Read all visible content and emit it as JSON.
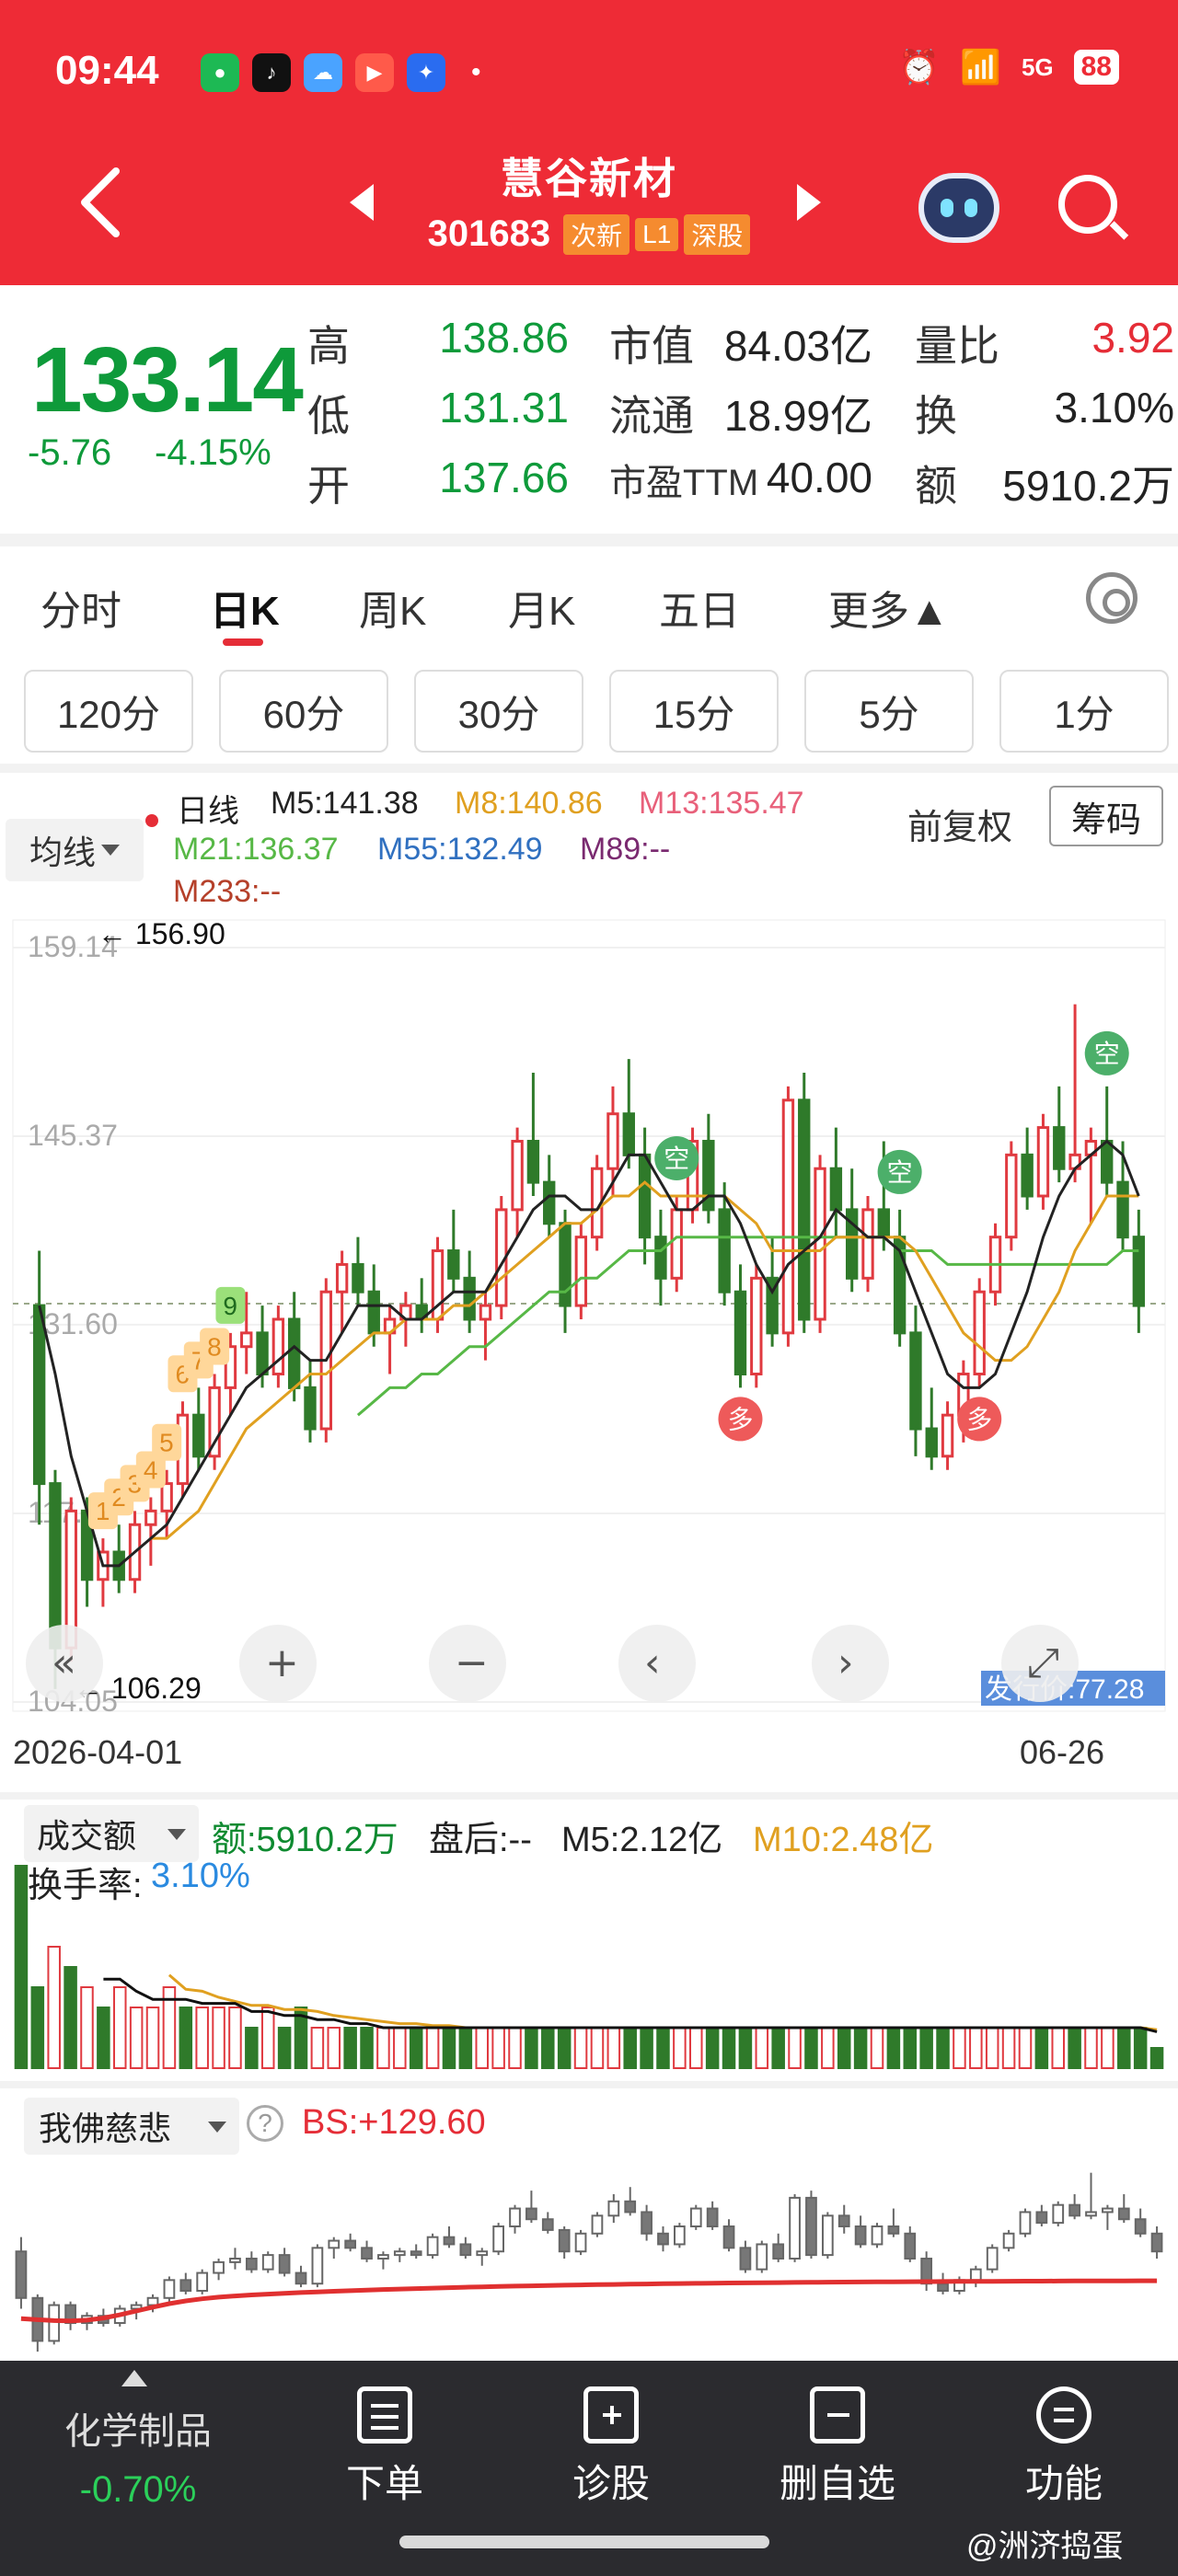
{
  "status_bar": {
    "time": "09:44",
    "battery": "88",
    "signal": "5G"
  },
  "header": {
    "stock_name": "慧谷新材",
    "code": "301683",
    "tags": [
      "次新",
      "L1",
      "深股"
    ]
  },
  "quote": {
    "price": "133.14",
    "change": "-5.76",
    "change_pct": "-4.15%",
    "rows": [
      {
        "l1": "高",
        "v1": "138.86",
        "l2": "市值",
        "v2": "84.03亿",
        "l3": "量比",
        "v3": "3.92"
      },
      {
        "l1": "低",
        "v1": "131.31",
        "l2": "流通",
        "v2": "18.99亿",
        "l3": "换",
        "v3": "3.10%"
      },
      {
        "l1": "开",
        "v1": "137.66",
        "l2": "市盈TTM",
        "v2": "40.00",
        "l3": "额",
        "v3": "5910.2万"
      }
    ]
  },
  "tabs": [
    "分时",
    "日K",
    "周K",
    "月K",
    "五日",
    "更多▲"
  ],
  "active_tab": "日K",
  "periods": [
    "120分",
    "60分",
    "30分",
    "15分",
    "5分",
    "1分"
  ],
  "ma_bar": {
    "selector": "均线",
    "title": "日线",
    "items": [
      {
        "label": "M5:141.38",
        "color": "#222222"
      },
      {
        "label": "M8:140.86",
        "color": "#e0a020"
      },
      {
        "label": "M13:135.47",
        "color": "#e8607a"
      },
      {
        "label": "M21:136.37",
        "color": "#57b846"
      },
      {
        "label": "M55:132.49",
        "color": "#3070c0"
      },
      {
        "label": "M89:--",
        "color": "#7a2a70"
      },
      {
        "label": "M233:--",
        "color": "#b5402a"
      }
    ],
    "adjust": "前复权",
    "chip_button": "筹码"
  },
  "chart_data": {
    "type": "candlestick",
    "y_ticks": [
      "159.14",
      "145.37",
      "131.60",
      "117.82",
      "104.05"
    ],
    "ylim": [
      104.05,
      159.14
    ],
    "annotations": {
      "high": "156.90",
      "low": "106.29",
      "issue_price": "发行价:77.28",
      "signals_kong": [
        "空",
        "空",
        "空"
      ],
      "signals_duo": [
        "多",
        "多"
      ],
      "counters": [
        "1",
        "2",
        "3",
        "4",
        "5",
        "6",
        "7",
        "8",
        "9"
      ]
    },
    "dates": [
      "2026-04-01",
      "06-26"
    ],
    "candles": [
      [
        133,
        137,
        117,
        120
      ],
      [
        120,
        121,
        105,
        108
      ],
      [
        108,
        119,
        107,
        118
      ],
      [
        118,
        119,
        111,
        113
      ],
      [
        113,
        116,
        111,
        115
      ],
      [
        115,
        117,
        112,
        113
      ],
      [
        113,
        118,
        112,
        117
      ],
      [
        117,
        119,
        114,
        118
      ],
      [
        118,
        121,
        116,
        120
      ],
      [
        120,
        126,
        119,
        125
      ],
      [
        125,
        127,
        121,
        122
      ],
      [
        122,
        128,
        121,
        127
      ],
      [
        127,
        131,
        125,
        130
      ],
      [
        130,
        134,
        128,
        131
      ],
      [
        131,
        133,
        127,
        128
      ],
      [
        128,
        133,
        127,
        132
      ],
      [
        132,
        134,
        126,
        127
      ],
      [
        127,
        129,
        123,
        124
      ],
      [
        124,
        135,
        123,
        134
      ],
      [
        134,
        137,
        131,
        136
      ],
      [
        136,
        138,
        133,
        134
      ],
      [
        134,
        136,
        130,
        131
      ],
      [
        131,
        133,
        128,
        132
      ],
      [
        132,
        134,
        130,
        133
      ],
      [
        133,
        135,
        131,
        132
      ],
      [
        132,
        138,
        131,
        137
      ],
      [
        137,
        140,
        134,
        135
      ],
      [
        135,
        137,
        131,
        132
      ],
      [
        132,
        134,
        129,
        133
      ],
      [
        133,
        141,
        132,
        140
      ],
      [
        140,
        146,
        138,
        145
      ],
      [
        145,
        150,
        141,
        142
      ],
      [
        142,
        144,
        138,
        139
      ],
      [
        139,
        140,
        131,
        133
      ],
      [
        133,
        139,
        132,
        138
      ],
      [
        138,
        144,
        137,
        143
      ],
      [
        143,
        149,
        141,
        147
      ],
      [
        147,
        151,
        143,
        144
      ],
      [
        144,
        146,
        136,
        138
      ],
      [
        138,
        140,
        133,
        135
      ],
      [
        135,
        141,
        134,
        140
      ],
      [
        140,
        146,
        139,
        145
      ],
      [
        145,
        147,
        139,
        140
      ],
      [
        140,
        142,
        133,
        134
      ],
      [
        134,
        136,
        127,
        128
      ],
      [
        128,
        136,
        127,
        135
      ],
      [
        135,
        138,
        130,
        131
      ],
      [
        131,
        149,
        130,
        148
      ],
      [
        148,
        150,
        131,
        132
      ],
      [
        132,
        144,
        131,
        143
      ],
      [
        143,
        146,
        138,
        140
      ],
      [
        140,
        143,
        134,
        135
      ],
      [
        135,
        141,
        134,
        140
      ],
      [
        140,
        145,
        137,
        138
      ],
      [
        138,
        140,
        130,
        131
      ],
      [
        131,
        133,
        122,
        124
      ],
      [
        124,
        127,
        121,
        122
      ],
      [
        122,
        126,
        121,
        125
      ],
      [
        125,
        129,
        123,
        128
      ],
      [
        128,
        135,
        127,
        134
      ],
      [
        134,
        139,
        133,
        138
      ],
      [
        138,
        145,
        137,
        144
      ],
      [
        144,
        146,
        140,
        141
      ],
      [
        141,
        147,
        140,
        146
      ],
      [
        146,
        149,
        142,
        143
      ],
      [
        143,
        155,
        142,
        144
      ],
      [
        144,
        146,
        139,
        145
      ],
      [
        145,
        149,
        141,
        142
      ],
      [
        142,
        145,
        137,
        138
      ],
      [
        138,
        140,
        131,
        133
      ]
    ],
    "ma5": [
      133,
      128,
      122,
      118,
      114,
      114,
      115,
      116,
      117,
      119,
      121,
      123,
      125,
      127,
      128,
      129,
      130,
      129,
      129,
      131,
      133,
      133,
      133,
      132,
      132,
      133,
      134,
      134,
      134,
      136,
      138,
      140,
      141,
      141,
      140,
      140,
      142,
      144,
      144,
      142,
      140,
      140,
      141,
      141,
      139,
      136,
      134,
      136,
      137,
      138,
      140,
      139,
      138,
      138,
      137,
      134,
      131,
      128,
      127,
      127,
      128,
      131,
      134,
      138,
      141,
      143,
      144,
      145,
      144,
      141
    ],
    "ma8": [
      null,
      null,
      null,
      null,
      null,
      null,
      null,
      116,
      116,
      117,
      118,
      120,
      122,
      124,
      125,
      126,
      127,
      128,
      128,
      129,
      130,
      131,
      131,
      132,
      132,
      132,
      133,
      133,
      134,
      135,
      136,
      137,
      138,
      139,
      139,
      140,
      141,
      141,
      142,
      141,
      141,
      141,
      141,
      141,
      140,
      139,
      137,
      137,
      137,
      137,
      138,
      138,
      138,
      138,
      138,
      137,
      135,
      133,
      131,
      130,
      129,
      129,
      130,
      132,
      134,
      137,
      139,
      141,
      141,
      141
    ],
    "ma21": [
      null,
      null,
      null,
      null,
      null,
      null,
      null,
      null,
      null,
      null,
      null,
      null,
      null,
      null,
      null,
      null,
      null,
      null,
      null,
      null,
      125,
      126,
      127,
      127,
      128,
      128,
      129,
      130,
      130,
      131,
      132,
      133,
      134,
      134,
      135,
      135,
      136,
      137,
      137,
      137,
      138,
      138,
      138,
      138,
      138,
      138,
      138,
      138,
      138,
      138,
      138,
      138,
      138,
      138,
      137,
      137,
      137,
      136,
      136,
      136,
      136,
      136,
      136,
      136,
      136,
      136,
      136,
      136,
      137,
      137
    ]
  },
  "volume": {
    "selector": "成交额",
    "amount": "额:5910.2万",
    "after_hours": "盘后:--",
    "m5": "M5:2.12亿",
    "m10": "M10:2.48亿",
    "turnover_label": "换手率:",
    "turnover": "3.10%",
    "bars": [
      10,
      4,
      6,
      5,
      4,
      3,
      4,
      3,
      3,
      4,
      3,
      3,
      3,
      3,
      2,
      3,
      2,
      3,
      2,
      2,
      2,
      2,
      2,
      2,
      2,
      2,
      2,
      2,
      2,
      2,
      2,
      2,
      2,
      2,
      2,
      2,
      2,
      2,
      2,
      2,
      2,
      2,
      2,
      2,
      2,
      2,
      2,
      2,
      2,
      2,
      2,
      2,
      2,
      2,
      2,
      2,
      2,
      2,
      2,
      2,
      2,
      2,
      2,
      2,
      2,
      2,
      2,
      2,
      2,
      1
    ]
  },
  "foshuo": {
    "selector": "我佛慈悲",
    "bs": "BS:+129.60"
  },
  "bottom_nav": {
    "sector_name": "化学制品",
    "sector_change": "-0.70%",
    "items": [
      {
        "label": "下单",
        "icon": "order-icon"
      },
      {
        "label": "诊股",
        "icon": "diagnose-icon"
      },
      {
        "label": "删自选",
        "icon": "remove-watchlist-icon"
      },
      {
        "label": "功能",
        "icon": "menu-icon"
      }
    ],
    "watermark": "@洲济捣蛋"
  }
}
